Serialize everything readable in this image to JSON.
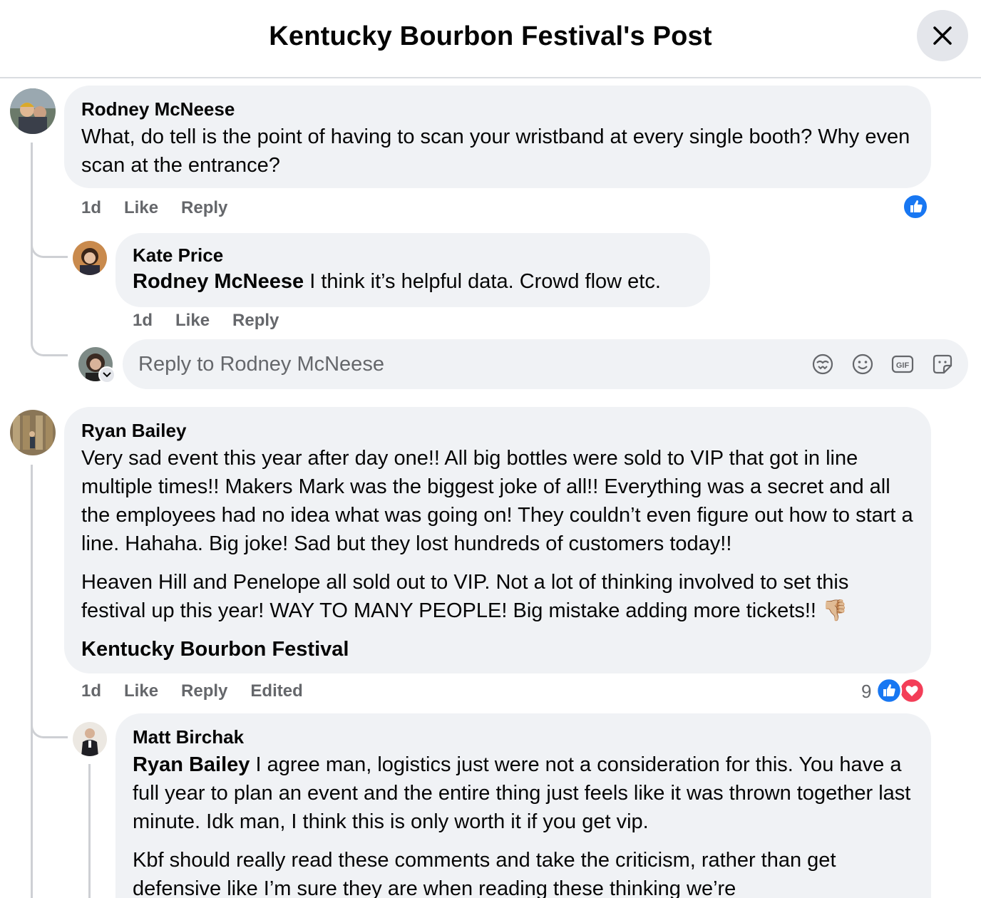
{
  "header": {
    "title": "Kentucky Bourbon Festival's Post"
  },
  "comments": [
    {
      "author": "Rodney McNeese",
      "text": "What, do tell is the point of having to scan your wristband at every single booth? Why even scan at the entrance?",
      "time": "1d",
      "like": "Like",
      "reply": "Reply"
    },
    {
      "author": "Kate Price",
      "mention": "Rodney McNeese",
      "text": " I think it’s helpful data. Crowd flow etc.",
      "time": "1d",
      "like": "Like",
      "reply": "Reply"
    },
    {
      "author": "Ryan Bailey",
      "paragraph1": "Very sad event this year after day one!! All big bottles were sold to VIP that got in line multiple times!! Makers Mark was the biggest joke of all!! Everything was a secret and all the employees had no idea what was going on! They couldn’t even figure out how to start a line. Hahaha. Big joke! Sad but they lost hundreds of customers today!!",
      "paragraph2": "Heaven Hill and Penelope all sold out to VIP. Not a lot of thinking involved to set this festival up this year! WAY TO MANY PEOPLE! Big mistake adding more tickets!! 👎🏼",
      "tag": "Kentucky Bourbon Festival",
      "time": "1d",
      "like": "Like",
      "reply": "Reply",
      "edited": "Edited",
      "reaction_count": "9"
    },
    {
      "author": "Matt Birchak",
      "mention": "Ryan Bailey",
      "paragraph1": " I agree man, logistics just were not a consideration for this. You have a full year to plan an event and the entire thing just feels like it was thrown together last minute. Idk man, I think this is only worth it if you get vip.",
      "paragraph2": "Kbf should really read these comments and take the criticism, rather than get defensive like I’m sure they are when reading these thinking we’re"
    }
  ],
  "reply_box": {
    "placeholder": "Reply to Rodney McNeese"
  },
  "colors": {
    "like_blue": "#1877f2",
    "love_red": "#f33e58",
    "bubble": "#f0f2f5",
    "muted": "#65676b"
  }
}
